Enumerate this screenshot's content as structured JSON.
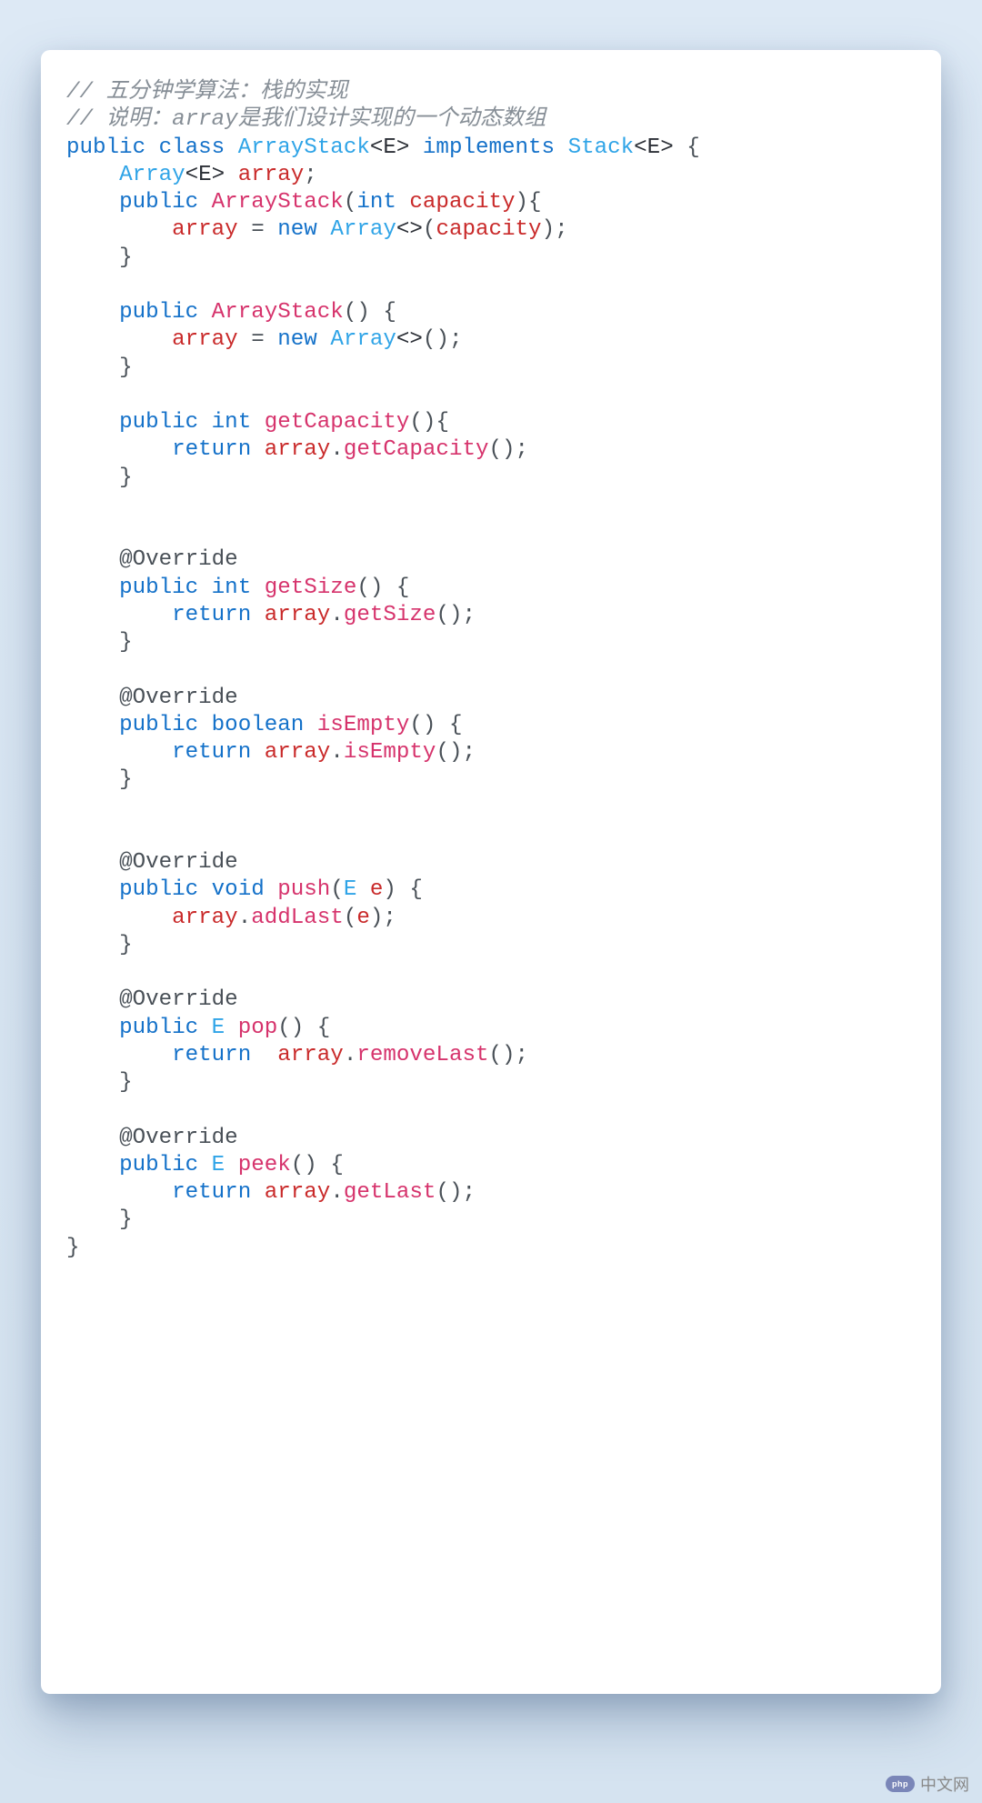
{
  "code": {
    "c1": "// 五分钟学算法：栈的实现",
    "c2": "// 说明：array是我们设计实现的一个动态数组",
    "kw_public": "public",
    "kw_class": "class",
    "ty_ArrayStack": "ArrayStack",
    "ty_Array": "Array",
    "ty_Stack": "Stack",
    "gen_E": "<E>",
    "gen_empty": "<>",
    "kw_implements": "implements",
    "kw_int": "int",
    "kw_boolean": "boolean",
    "kw_void": "void",
    "kw_return": "return",
    "kw_new": "new",
    "id_array": "array",
    "id_capacity": "capacity",
    "id_e": "e",
    "ty_E": "E",
    "fn_ArrayStack": "ArrayStack",
    "fn_getCapacity": "getCapacity",
    "fn_getSize": "getSize",
    "fn_isEmpty": "isEmpty",
    "fn_push": "push",
    "fn_pop": "pop",
    "fn_peek": "peek",
    "fn_addLast": "addLast",
    "fn_removeLast": "removeLast",
    "fn_getLast": "getLast",
    "ann_Override": "@Override",
    "lbrace": "{",
    "rbrace": "}",
    "lparen": "(",
    "rparen": ")",
    "semi": ";",
    "eq": "=",
    "dot": "."
  },
  "watermark": {
    "logo_text": "php",
    "label": "中文网"
  }
}
